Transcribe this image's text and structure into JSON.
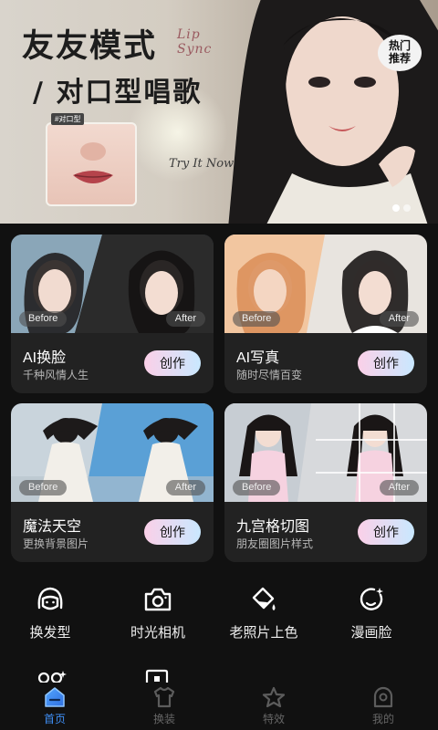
{
  "banner": {
    "title_line1": "友友模式",
    "english_line1": "Lip",
    "english_line2": "Sync",
    "title_line2": "/ 对口型唱歌",
    "thumb_tag": "#对口型",
    "script_text": "Try It Now",
    "hot_badge_line1": "热门",
    "hot_badge_line2": "推荐",
    "carousel_total": 2,
    "carousel_active": 1
  },
  "cards": [
    {
      "title": "AI换脸",
      "subtitle": "千种风情人生",
      "button": "创作",
      "before": "Before",
      "after": "After"
    },
    {
      "title": "AI写真",
      "subtitle": "随时尽情百变",
      "button": "创作",
      "before": "Before",
      "after": "After"
    },
    {
      "title": "魔法天空",
      "subtitle": "更换背景图片",
      "button": "创作",
      "before": "Before",
      "after": "After"
    },
    {
      "title": "九宫格切图",
      "subtitle": "朋友圈图片样式",
      "button": "创作",
      "before": "Before",
      "after": "After"
    }
  ],
  "tools": [
    {
      "label": "换发型",
      "icon": "hair-icon"
    },
    {
      "label": "时光相机",
      "icon": "camera-icon"
    },
    {
      "label": "老照片上色",
      "icon": "paint-bucket-icon"
    },
    {
      "label": "漫画脸",
      "icon": "cartoon-face-icon"
    }
  ],
  "nav": [
    {
      "label": "首页",
      "icon": "home-icon",
      "active": true
    },
    {
      "label": "换装",
      "icon": "shirt-icon",
      "active": false
    },
    {
      "label": "特效",
      "icon": "star-icon",
      "active": false
    },
    {
      "label": "我的",
      "icon": "profile-icon",
      "active": false
    }
  ],
  "colors": {
    "background": "#111111",
    "card": "#222222",
    "button_gradient_start": "#fbd0e8",
    "button_gradient_end": "#c9e8ff",
    "nav_active": "#3f8ff5",
    "nav_inactive": "#666666"
  }
}
